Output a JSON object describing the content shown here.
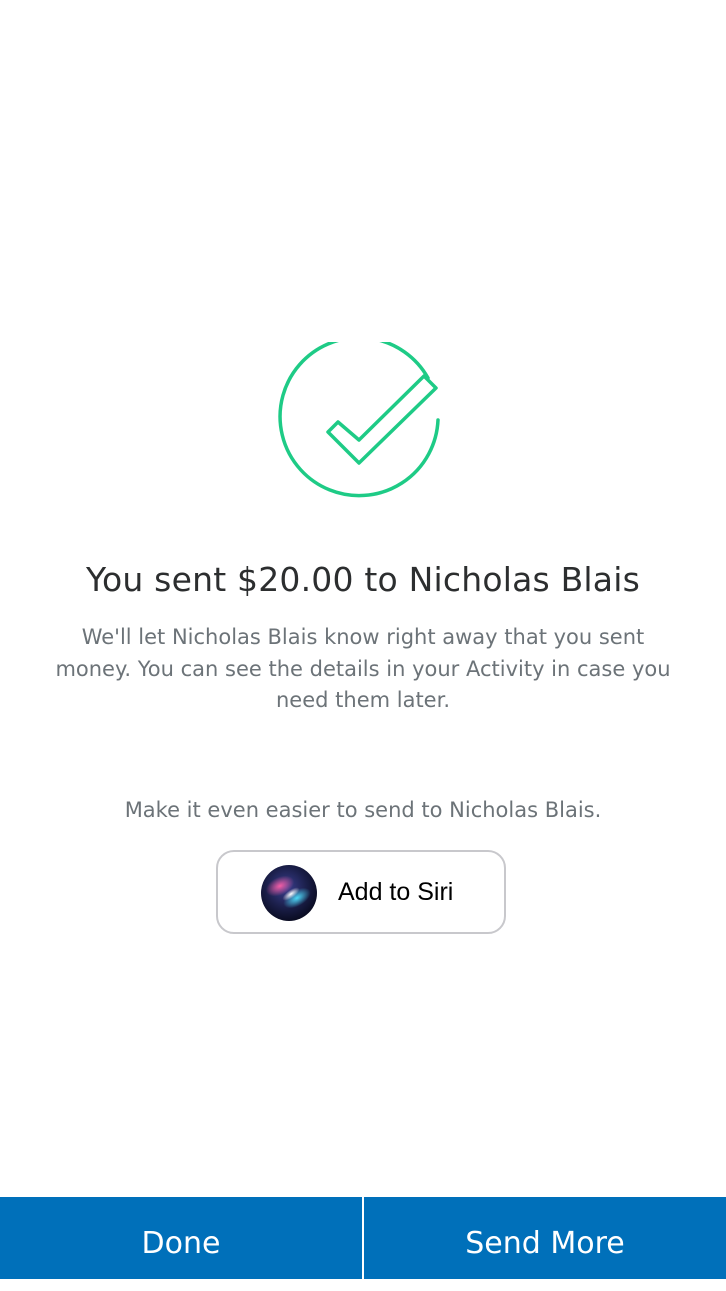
{
  "confirmation": {
    "headline": "You sent $20.00 to Nicholas Blais",
    "message": "We'll let Nicholas Blais know right away that you sent money. You can see the details in your Activity in case you need them later.",
    "icon": "checkmark-circle-icon",
    "icon_color": "#1ecb86"
  },
  "siri": {
    "prompt": "Make it even easier to send to Nicholas Blais.",
    "button_label": "Add to Siri",
    "icon": "siri-icon"
  },
  "footer": {
    "done_label": "Done",
    "send_more_label": "Send More",
    "background_color": "#0070ba"
  }
}
